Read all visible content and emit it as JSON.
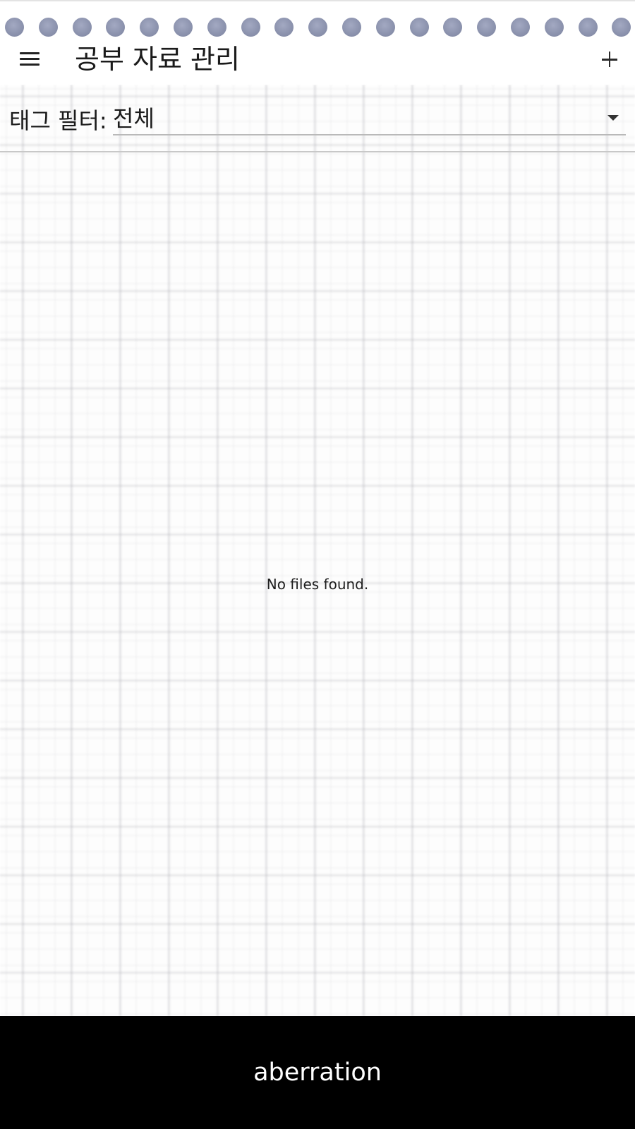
{
  "app_bar": {
    "title": "공부 자료 관리",
    "menu_icon": "menu-icon",
    "add_icon": "add-icon"
  },
  "filter": {
    "label": "태그 필터:",
    "selected": "전체",
    "dropdown_icon": "dropdown-arrow-icon"
  },
  "content": {
    "empty_message": "No files found."
  },
  "bottom_bar": {
    "text": "aberration"
  },
  "colors": {
    "dot": "#8b92ad",
    "bottom_bar": "#000000",
    "text": "#1b1b1b"
  }
}
